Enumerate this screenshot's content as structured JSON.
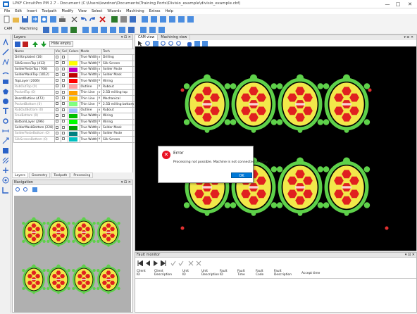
{
  "window": {
    "title": "LPKF CircuitPro PM 2.7 - Document (C:\\Users\\lewdnor\\Documents\\Training Ports\\Divisio_example\\divisio_example.cbf)",
    "minimize": "—",
    "maximize": "□",
    "close": "✕"
  },
  "menu": [
    "File",
    "Edit",
    "Insert",
    "Toolpath",
    "Modify",
    "View",
    "Select",
    "Wizards",
    "Machining",
    "Extras",
    "Help"
  ],
  "toolbar2": {
    "cam": "CAM",
    "machining": "Machining"
  },
  "layers_panel": {
    "title": "Layers",
    "pin": "▾ ⊡ ✕",
    "hide_empty": "Hide empty",
    "columns": [
      "Name",
      "Vis",
      "Sel",
      "Colors",
      "Mode",
      "Tech"
    ],
    "rows": [
      {
        "name": "DrillUnplated (16)",
        "color": "#ffffff",
        "mode": "True Width",
        "tech": "Drilling",
        "grey": false
      },
      {
        "name": "SilkScreenTop (412)",
        "color": "#ffff00",
        "mode": "True Width",
        "tech": "Silk Screen",
        "grey": false
      },
      {
        "name": "SolderPasteTop (768)",
        "color": "#c000c0",
        "mode": "True Width",
        "tech": "Solder Paste",
        "grey": false
      },
      {
        "name": "SolderMaskTop (1012)",
        "color": "#c00000",
        "mode": "True Width",
        "tech": "Solder Mask",
        "grey": false
      },
      {
        "name": "TopLayer (2006)",
        "color": "#ff0000",
        "mode": "True Width",
        "tech": "Wiring",
        "grey": false
      },
      {
        "name": "RubOutTop (0)",
        "color": "#ffa0a0",
        "mode": "Outline",
        "tech": "Rubout",
        "grey": true
      },
      {
        "name": "PocketTop (0)",
        "color": "#ffa000",
        "mode": "Thin Line",
        "tech": "2.5D milling top",
        "grey": true
      },
      {
        "name": "BoardOutline (472)",
        "color": "#ffc000",
        "mode": "Thin Line",
        "tech": "Mechanical",
        "grey": false
      },
      {
        "name": "PocketBottom (0)",
        "color": "#80ff80",
        "mode": "Thin Line",
        "tech": "2.5D milling bottom",
        "grey": true
      },
      {
        "name": "RubOutBottom (0)",
        "color": "#a0c0ff",
        "mode": "Outline",
        "tech": "Rubout",
        "grey": true
      },
      {
        "name": "FreeBottom (0)",
        "color": "#00c000",
        "mode": "True Width",
        "tech": "Wiring",
        "grey": true
      },
      {
        "name": "BottomLayer (296)",
        "color": "#00ff00",
        "mode": "True Width",
        "tech": "Wiring",
        "grey": false
      },
      {
        "name": "SolderMaskBottom (228)",
        "color": "#00a000",
        "mode": "True Width",
        "tech": "Solder Mask",
        "grey": false
      },
      {
        "name": "SolderPasteBottom (0)",
        "color": "#008080",
        "mode": "True Width",
        "tech": "Solder Paste",
        "grey": true
      },
      {
        "name": "SilkScreenBottom (0)",
        "color": "#00c0c0",
        "mode": "True Width",
        "tech": "Silk Screen",
        "grey": true
      }
    ],
    "tabs": [
      "Layers",
      "Geometry",
      "Toolpath",
      "Processing"
    ]
  },
  "navigation": {
    "title": "Navigation",
    "pin": "▾ ⊡ ✕"
  },
  "cam_view": {
    "tabs": [
      "CAM view",
      "Machining view"
    ],
    "pin": "▾ ⊡ ✕"
  },
  "fault_monitor": {
    "title": "Fault monitor",
    "pin": "▾ ⊡ ✕",
    "columns": [
      "Client\nID",
      "Client\nDescription",
      "Unit\nID",
      "Unit\nDescription",
      "Fault\nID",
      "Fault\nTime",
      "Fault\nCode",
      "Fault\nDescription",
      "Accept time"
    ]
  },
  "dialog": {
    "title": "Error",
    "message": "Processing not possible. Machine is not connected or busy.",
    "ok": "OK",
    "icon": "✕"
  },
  "colors": {
    "board_bg": "#000000",
    "accent": "#0078d7",
    "pad_green": "#5ed14a",
    "pad_yellow": "#f2e84a",
    "pad_red": "#e02020"
  }
}
